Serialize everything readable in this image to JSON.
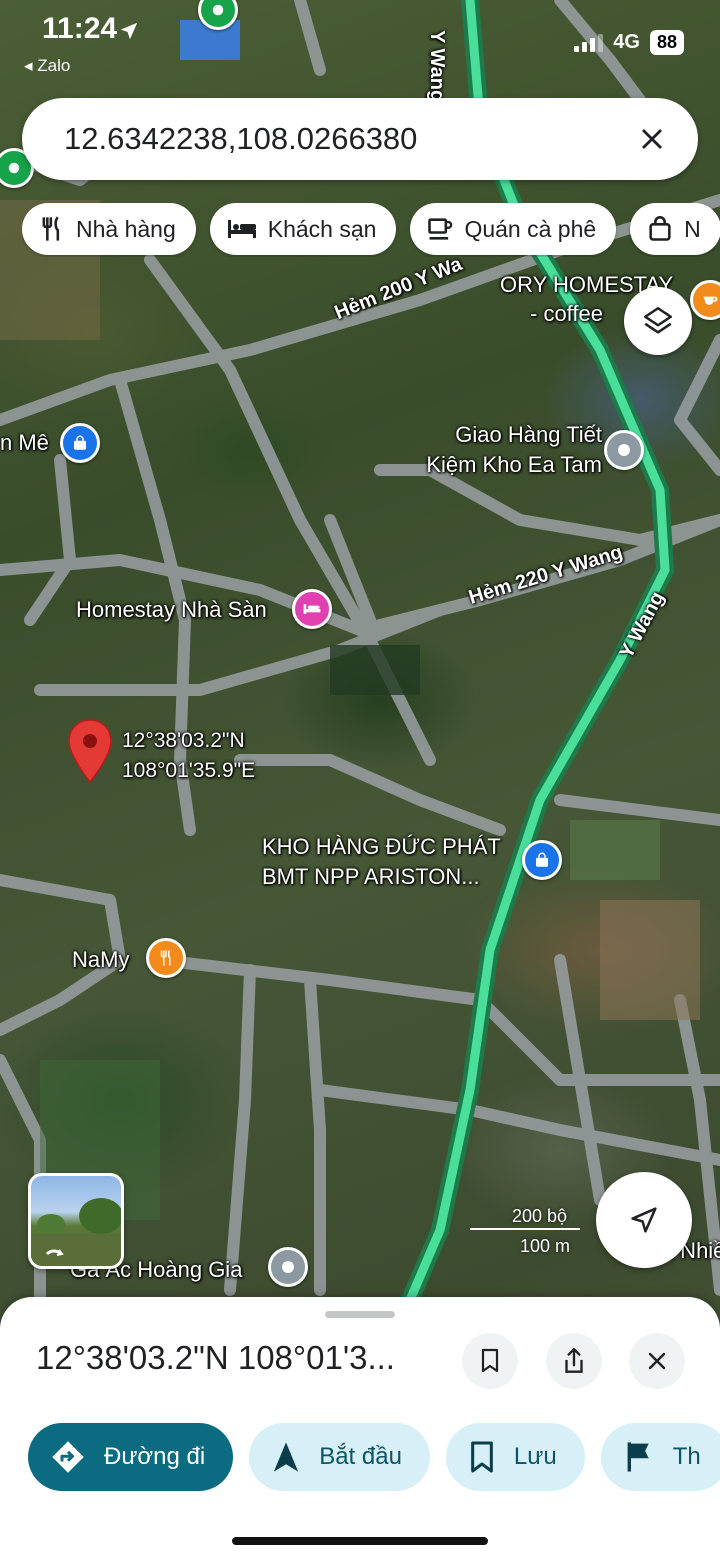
{
  "status_bar": {
    "time": "11:24",
    "back_app": "Zalo",
    "network": "4G",
    "battery": "88"
  },
  "search": {
    "query": "12.6342238,108.0266380"
  },
  "chips": [
    {
      "label": "Nhà hàng",
      "icon": "restaurant-icon"
    },
    {
      "label": "Khách sạn",
      "icon": "hotel-icon"
    },
    {
      "label": "Quán cà phê",
      "icon": "cafe-icon"
    },
    {
      "label": "N",
      "icon": "shopping-bag-icon"
    }
  ],
  "map": {
    "roads": [
      "Y Wang",
      "Hẻm 200 Y Wa",
      "Hẻm 220 Y Wang",
      "Y Wang"
    ],
    "places": [
      {
        "name": "ORY HOMESTAY - coffee",
        "line1": "ORY HOMESTAY",
        "line2": "- coffee"
      },
      {
        "name": "Giao Hàng Tiết Kiệm Kho Ea Tam",
        "line1": "Giao Hàng Tiết",
        "line2": "Kiệm Kho Ea Tam"
      },
      {
        "name": "n Mê"
      },
      {
        "name": "Homestay Nhà Sàn"
      },
      {
        "name": "KHO HÀNG ĐỨC PHÁT BMT NPP ARISTON...",
        "line1": "KHO HÀNG ĐỨC PHÁT",
        "line2": "BMT NPP ARISTON..."
      },
      {
        "name": "NaMy"
      },
      {
        "name": "Gà Ác Hoàng Gia"
      },
      {
        "name": "Vườn Nhiề"
      }
    ],
    "dropped_pin": {
      "lat": "12°38'03.2\"N",
      "lng": "108°01'35.9\"E"
    },
    "scale": {
      "imperial": "200 bộ",
      "metric": "100 m"
    }
  },
  "sheet": {
    "title": "12°38'03.2\"N 108°01'3...",
    "actions": [
      {
        "label": "Đường đi",
        "icon": "directions-icon"
      },
      {
        "label": "Bắt đầu",
        "icon": "navigation-arrow-icon"
      },
      {
        "label": "Lưu",
        "icon": "bookmark-icon"
      },
      {
        "label": "Th",
        "icon": "flag-icon"
      }
    ]
  },
  "colors": {
    "accent": "#0b6b80",
    "route": "#34d399",
    "pin_red": "#e53935"
  }
}
